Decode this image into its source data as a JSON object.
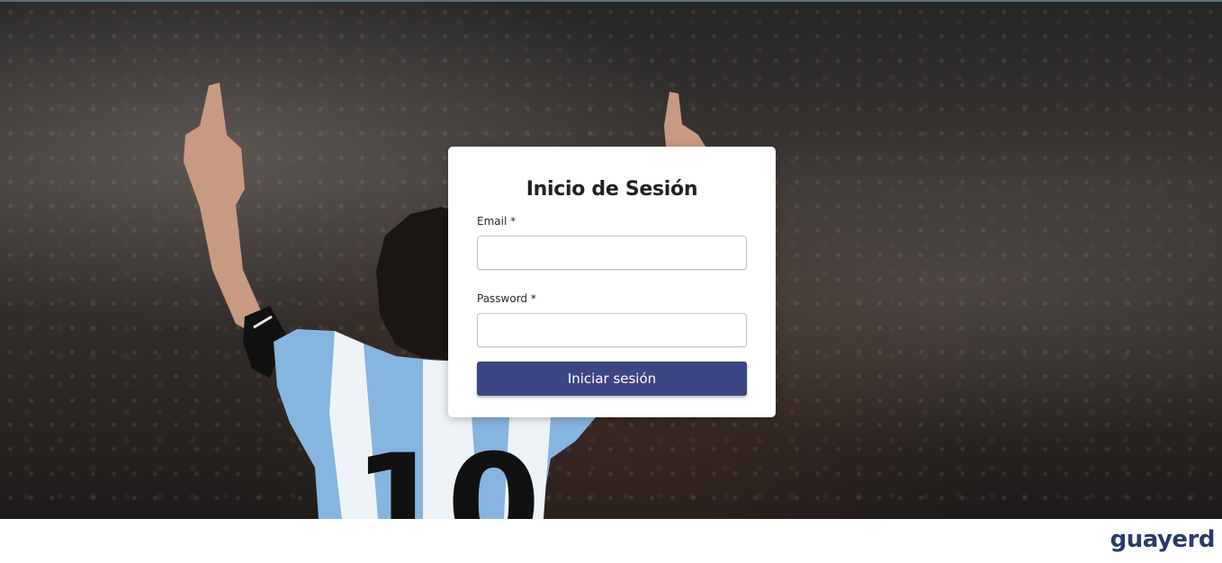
{
  "login": {
    "title": "Inicio de Sesión",
    "email_label": "Email",
    "email_required_mark": "*",
    "email_value": "",
    "password_label": "Password",
    "password_required_mark": "*",
    "password_value": "",
    "submit_label": "Iniciar sesión"
  },
  "footer": {
    "brand": "guayerd"
  },
  "colors": {
    "primary_button": "#3d4684",
    "brand": "#2a3b6b",
    "card_background": "#ffffff"
  },
  "background": {
    "shirt_number": "10"
  }
}
